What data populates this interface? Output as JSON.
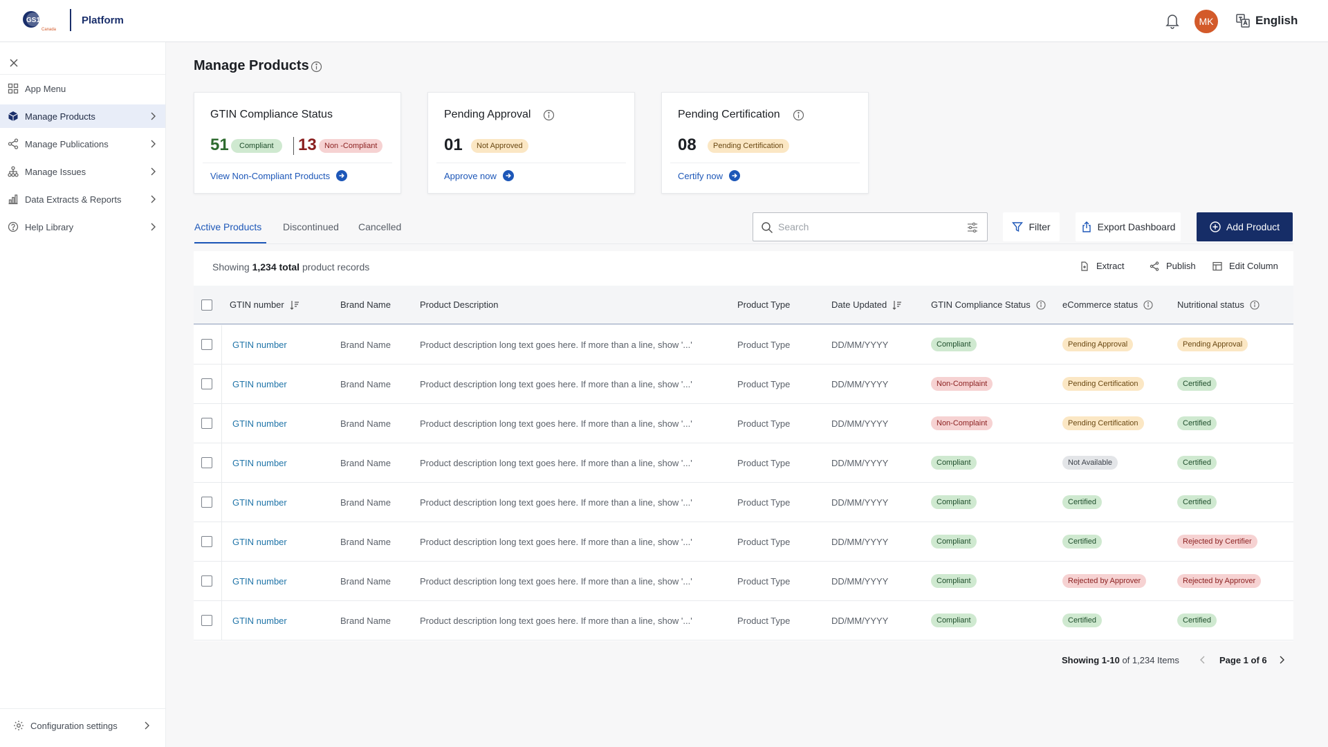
{
  "topbar": {
    "logo_text": "GS1",
    "logo_sub": "Canada",
    "platform": "Platform",
    "avatar_initials": "MK",
    "language": "English"
  },
  "sidebar": {
    "items": [
      {
        "label": "App Menu",
        "icon": "grid-icon"
      },
      {
        "label": "Manage Products",
        "icon": "box-icon",
        "active": true
      },
      {
        "label": "Manage Publications",
        "icon": "share-icon"
      },
      {
        "label": "Manage Issues",
        "icon": "hierarchy-icon"
      },
      {
        "label": "Data Extracts & Reports",
        "icon": "bar-chart-icon"
      },
      {
        "label": "Help Library",
        "icon": "help-icon"
      }
    ],
    "config_label": "Configuration settings"
  },
  "page": {
    "title": "Manage Products"
  },
  "cards": {
    "gtin": {
      "title": "GTIN Compliance Status",
      "compliant_count": "51",
      "compliant_label": "Compliant",
      "noncompliant_count": "13",
      "noncompliant_label": "Non -Compliant",
      "link": "View Non-Compliant Products"
    },
    "approval": {
      "title": "Pending Approval",
      "count": "01",
      "badge": "Not Approved",
      "link": "Approve now"
    },
    "certification": {
      "title": "Pending Certification",
      "count": "08",
      "badge": "Pending Certification",
      "link": "Certify now"
    }
  },
  "tabs": [
    "Active Products",
    "Discontinued",
    "Cancelled"
  ],
  "toolbar": {
    "search_placeholder": "Search",
    "filter": "Filter",
    "export": "Export Dashboard",
    "add": "Add Product"
  },
  "table": {
    "showing_prefix": "Showing",
    "total": "1,234 total",
    "showing_suffix": "product records",
    "actions": [
      "Extract",
      "Publish",
      "Edit Column"
    ],
    "headers": [
      "GTIN number",
      "Brand Name",
      "Product Description",
      "Product Type",
      "Date Updated",
      "GTIN Compliance Status",
      "eCommerce status",
      "Nutritional status"
    ],
    "rows": [
      {
        "gtin": "GTIN number",
        "brand": "Brand Name",
        "desc": "Product description long text goes here. If more than a line, show '...'",
        "type": "Product Type",
        "date": "DD/MM/YYYY",
        "compliance": "Compliant",
        "compliance_color": "green",
        "ecom": "Pending Approval",
        "ecom_color": "yellow",
        "nutri": "Pending Approval",
        "nutri_color": "yellow"
      },
      {
        "gtin": "GTIN number",
        "brand": "Brand Name",
        "desc": "Product description long text goes here. If more than a line, show '...'",
        "type": "Product Type",
        "date": "DD/MM/YYYY",
        "compliance": "Non-Complaint",
        "compliance_color": "red",
        "ecom": "Pending Certification",
        "ecom_color": "yellow",
        "nutri": "Certified",
        "nutri_color": "green"
      },
      {
        "gtin": "GTIN number",
        "brand": "Brand Name",
        "desc": "Product description long text goes here. If more than a line, show '...'",
        "type": "Product Type",
        "date": "DD/MM/YYYY",
        "compliance": "Non-Complaint",
        "compliance_color": "red",
        "ecom": "Pending Certification",
        "ecom_color": "yellow",
        "nutri": "Certified",
        "nutri_color": "green"
      },
      {
        "gtin": "GTIN number",
        "brand": "Brand Name",
        "desc": "Product description long text goes here. If more than a line, show '...'",
        "type": "Product Type",
        "date": "DD/MM/YYYY",
        "compliance": "Compliant",
        "compliance_color": "green",
        "ecom": "Not Available",
        "ecom_color": "grey",
        "nutri": "Certified",
        "nutri_color": "green"
      },
      {
        "gtin": "GTIN number",
        "brand": "Brand Name",
        "desc": "Product description long text goes here. If more than a line, show '...'",
        "type": "Product Type",
        "date": "DD/MM/YYYY",
        "compliance": "Compliant",
        "compliance_color": "green",
        "ecom": "Certified",
        "ecom_color": "green",
        "nutri": "Certified",
        "nutri_color": "green"
      },
      {
        "gtin": "GTIN number",
        "brand": "Brand Name",
        "desc": "Product description long text goes here. If more than a line, show '...'",
        "type": "Product Type",
        "date": "DD/MM/YYYY",
        "compliance": "Compliant",
        "compliance_color": "green",
        "ecom": "Certified",
        "ecom_color": "green",
        "nutri": "Rejected by Certifier",
        "nutri_color": "red"
      },
      {
        "gtin": "GTIN number",
        "brand": "Brand Name",
        "desc": "Product description long text goes here. If more than a line, show '...'",
        "type": "Product Type",
        "date": "DD/MM/YYYY",
        "compliance": "Compliant",
        "compliance_color": "green",
        "ecom": "Rejected by Approver",
        "ecom_color": "red",
        "nutri": "Rejected by Approver",
        "nutri_color": "red"
      },
      {
        "gtin": "GTIN number",
        "brand": "Brand Name",
        "desc": "Product description long text goes here. If more than a line, show '...'",
        "type": "Product Type",
        "date": "DD/MM/YYYY",
        "compliance": "Compliant",
        "compliance_color": "green",
        "ecom": "Certified",
        "ecom_color": "green",
        "nutri": "Certified",
        "nutri_color": "green"
      }
    ]
  },
  "pagination": {
    "showing": "Showing",
    "range": "1-10",
    "of_items": "of 1,234 Items",
    "page": "Page 1 of 6"
  },
  "colors": {
    "brand_navy": "#162d67",
    "link_blue": "#1d57b8",
    "avatar": "#d35a2a"
  }
}
